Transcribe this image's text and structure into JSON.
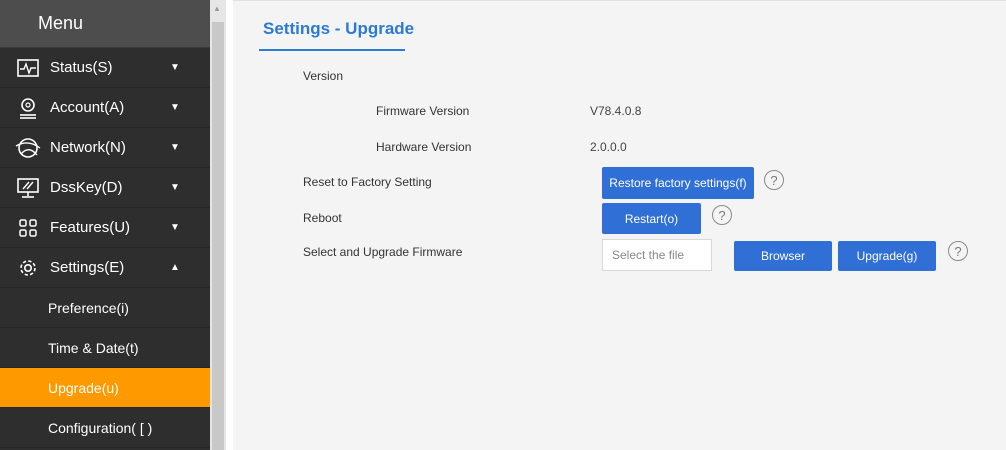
{
  "sidebar": {
    "title": "Menu",
    "items": [
      {
        "label": "Status(S)",
        "icon": "status-icon",
        "caret": "▼"
      },
      {
        "label": "Account(A)",
        "icon": "account-icon",
        "caret": "▼"
      },
      {
        "label": "Network(N)",
        "icon": "network-icon",
        "caret": "▼"
      },
      {
        "label": "DssKey(D)",
        "icon": "dsskey-icon",
        "caret": "▼"
      },
      {
        "label": "Features(U)",
        "icon": "features-icon",
        "caret": "▼"
      },
      {
        "label": "Settings(E)",
        "icon": "settings-icon",
        "caret": "▲"
      }
    ],
    "subitems": [
      {
        "label": "Preference(i)"
      },
      {
        "label": "Time & Date(t)"
      },
      {
        "label": "Upgrade(u)",
        "active": true
      },
      {
        "label": "Configuration( [ )"
      }
    ],
    "active_color": "#ff9900"
  },
  "main": {
    "title": "Settings - Upgrade",
    "version_label": "Version",
    "firmware_label": "Firmware Version",
    "firmware_value": "V78.4.0.8",
    "hardware_label": "Hardware Version",
    "hardware_value": "2.0.0.0",
    "reset_label": "Reset to Factory Setting",
    "restore_button": "Restore factory settings(f)",
    "reboot_label": "Reboot",
    "restart_button": "Restart(o)",
    "upgrade_label": "Select and Upgrade Firmware",
    "file_placeholder": "Select the file",
    "browser_button": "Browser",
    "upgrade_button": "Upgrade(g)",
    "help": "?",
    "accent_color": "#2f6fd6"
  }
}
